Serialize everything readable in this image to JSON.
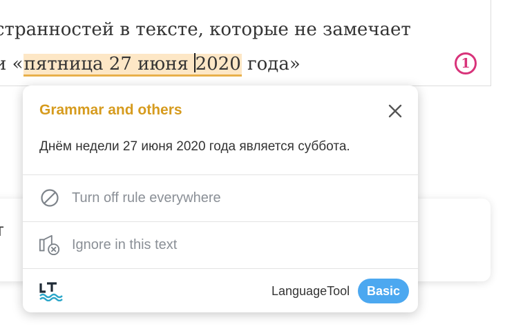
{
  "editor": {
    "line1_text": "странностей в тексте, которые не замечает",
    "line2_prefix": "и «",
    "line2_highlight_a": "пятница 27 июня ",
    "line2_highlight_b": "2020",
    "line2_suffix": " года»",
    "error_count": "1"
  },
  "background_card": {
    "text": "е т"
  },
  "popup": {
    "title": "Grammar and others",
    "message": "Днём недели 27 июня 2020 года является суббота.",
    "actions": [
      {
        "label": "Turn off rule everywhere",
        "icon": "prohibited-icon"
      },
      {
        "label": "Ignore in this text",
        "icon": "ignore-icon"
      }
    ],
    "footer": {
      "brand": "LanguageTool",
      "plan": "Basic"
    }
  },
  "colors": {
    "title": "#d69b1e",
    "highlight_bg": "#fde7c6",
    "highlight_underline": "#e8b04a",
    "badge_ring": "#d8337a",
    "plan_badge": "#4ca8f0",
    "logo_wave": "#2aa6c9"
  }
}
